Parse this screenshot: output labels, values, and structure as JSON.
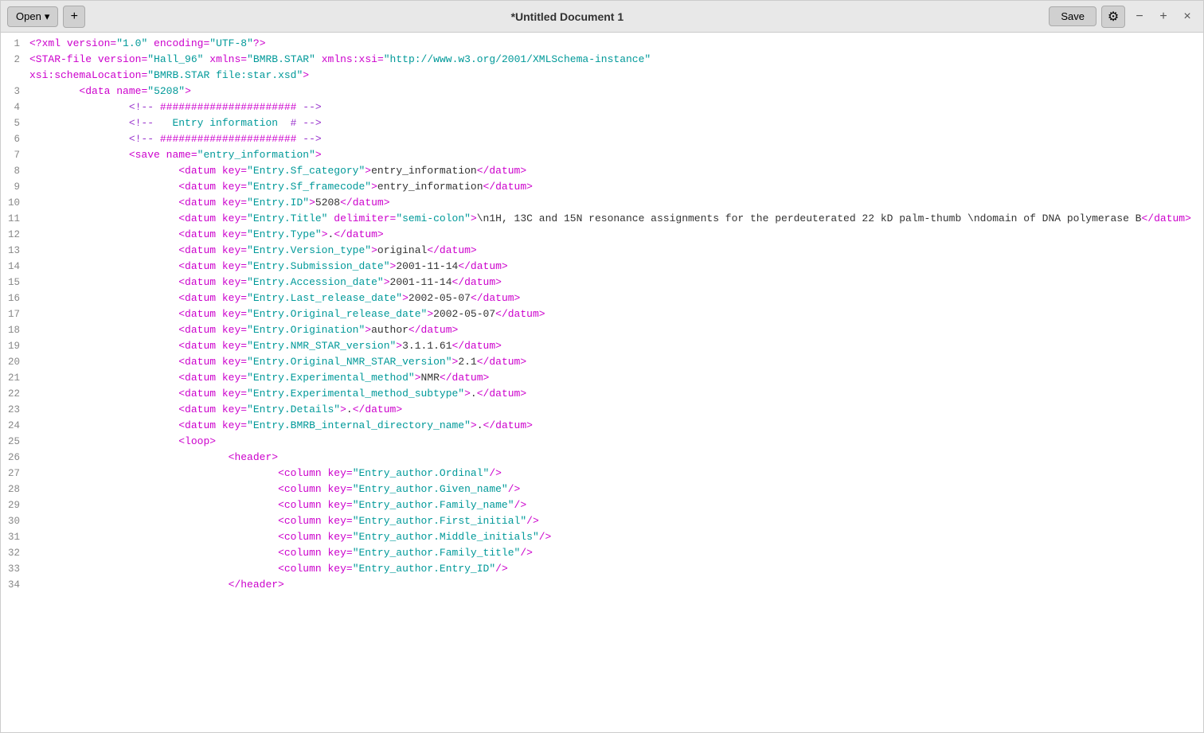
{
  "titlebar": {
    "open_label": "Open",
    "plus_label": "+",
    "title": "*Untitled Document 1",
    "save_label": "Save",
    "gear_label": "⚙",
    "min_label": "−",
    "max_label": "+",
    "close_label": "×"
  },
  "lines": [
    {
      "num": 1,
      "content": "<?xml version=\"1.0\" encoding=\"UTF-8\"?>"
    },
    {
      "num": 2,
      "content": "<STAR-file version=\"Hall_96\" xmlns=\"BMRB.STAR\" xmlns:xsi=\"http://www.w3.org/2001/XMLSchema-instance\""
    },
    {
      "num": "",
      "content": "xsi:schemaLocation=\"BMRB.STAR file:star.xsd\">"
    },
    {
      "num": 3,
      "content": "        <data name=\"5208\">"
    },
    {
      "num": 4,
      "content": "                <!-- ###################### -->"
    },
    {
      "num": 5,
      "content": "                <!--   Entry information  # -->"
    },
    {
      "num": 6,
      "content": "                <!-- ###################### -->"
    },
    {
      "num": 7,
      "content": "                <save name=\"entry_information\">"
    },
    {
      "num": 8,
      "content": "                        <datum key=\"Entry.Sf_category\">entry_information</datum>"
    },
    {
      "num": 9,
      "content": "                        <datum key=\"Entry.Sf_framecode\">entry_information</datum>"
    },
    {
      "num": 10,
      "content": "                        <datum key=\"Entry.ID\">5208</datum>"
    },
    {
      "num": 11,
      "content": "                        <datum key=\"Entry.Title\" delimiter=\"semi-colon\">\\n1H, 13C and 15N resonance assignments for the perdeuterated 22 kD palm-thumb \\ndomain of DNA polymerase B</datum>"
    },
    {
      "num": 12,
      "content": "                        <datum key=\"Entry.Type\">.</datum>"
    },
    {
      "num": 13,
      "content": "                        <datum key=\"Entry.Version_type\">original</datum>"
    },
    {
      "num": 14,
      "content": "                        <datum key=\"Entry.Submission_date\">2001-11-14</datum>"
    },
    {
      "num": 15,
      "content": "                        <datum key=\"Entry.Accession_date\">2001-11-14</datum>"
    },
    {
      "num": 16,
      "content": "                        <datum key=\"Entry.Last_release_date\">2002-05-07</datum>"
    },
    {
      "num": 17,
      "content": "                        <datum key=\"Entry.Original_release_date\">2002-05-07</datum>"
    },
    {
      "num": 18,
      "content": "                        <datum key=\"Entry.Origination\">author</datum>"
    },
    {
      "num": 19,
      "content": "                        <datum key=\"Entry.NMR_STAR_version\">3.1.1.61</datum>"
    },
    {
      "num": 20,
      "content": "                        <datum key=\"Entry.Original_NMR_STAR_version\">2.1</datum>"
    },
    {
      "num": 21,
      "content": "                        <datum key=\"Entry.Experimental_method\">NMR</datum>"
    },
    {
      "num": 22,
      "content": "                        <datum key=\"Entry.Experimental_method_subtype\">.</datum>"
    },
    {
      "num": 23,
      "content": "                        <datum key=\"Entry.Details\">.</datum>"
    },
    {
      "num": 24,
      "content": "                        <datum key=\"Entry.BMRB_internal_directory_name\">.</datum>"
    },
    {
      "num": 25,
      "content": "                        <loop>"
    },
    {
      "num": 26,
      "content": "                                <header>"
    },
    {
      "num": 27,
      "content": "                                        <column key=\"Entry_author.Ordinal\"/>"
    },
    {
      "num": 28,
      "content": "                                        <column key=\"Entry_author.Given_name\"/>"
    },
    {
      "num": 29,
      "content": "                                        <column key=\"Entry_author.Family_name\"/>"
    },
    {
      "num": 30,
      "content": "                                        <column key=\"Entry_author.First_initial\"/>"
    },
    {
      "num": 31,
      "content": "                                        <column key=\"Entry_author.Middle_initials\"/>"
    },
    {
      "num": 32,
      "content": "                                        <column key=\"Entry_author.Family_title\"/>"
    },
    {
      "num": 33,
      "content": "                                        <column key=\"Entry_author.Entry_ID\"/>"
    },
    {
      "num": 34,
      "content": "                                </header>"
    }
  ]
}
